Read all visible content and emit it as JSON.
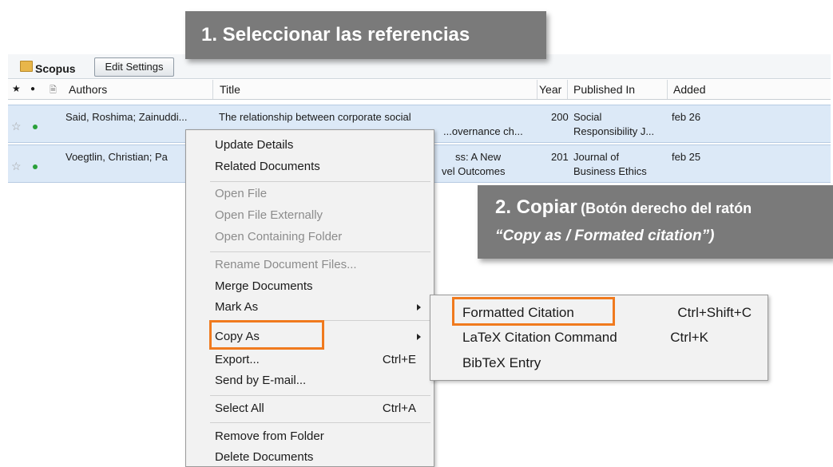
{
  "annotations": {
    "step1": "1.  Seleccionar las referencias",
    "step2_title": "2. Copiar",
    "step2_sub": "(Botón derecho del ratón",
    "step2_line2": "“Copy as / Formated citation”)"
  },
  "folder": {
    "name": "Scopus",
    "edit_settings": "Edit Settings"
  },
  "table": {
    "headers": {
      "star": "★",
      "read": "●",
      "doc": "🗎",
      "authors": "Authors",
      "title": "Title",
      "year": "Year",
      "published": "Published In",
      "added": "Added"
    },
    "rows": [
      {
        "authors": "Said, Roshima; Zainuddi...",
        "title_1": "The relationship between corporate social",
        "title_2": "...overnance ch...",
        "year": "200",
        "published_1": "Social",
        "published_2": "Responsibility J...",
        "added": "feb 26"
      },
      {
        "authors": "Voegtlin, Christian; Pa",
        "title_1": "ss: A New",
        "title_2": "vel Outcomes",
        "year": "201",
        "published_1": "Journal of",
        "published_2": "Business Ethics",
        "added": "feb 25"
      }
    ]
  },
  "context_menu": {
    "update_details": "Update Details",
    "related_documents": "Related Documents",
    "open_file": "Open File",
    "open_file_externally": "Open File Externally",
    "open_containing_folder": "Open Containing Folder",
    "rename_document_files": "Rename Document Files...",
    "merge_documents": "Merge Documents",
    "mark_as": "Mark As",
    "copy_as": "Copy As",
    "export": "Export...",
    "export_shortcut": "Ctrl+E",
    "send_by_email": "Send by E-mail...",
    "select_all": "Select All",
    "select_all_shortcut": "Ctrl+A",
    "remove_from_folder": "Remove from Folder",
    "delete_documents": "Delete Documents"
  },
  "submenu": {
    "formatted_citation": "Formatted Citation",
    "formatted_citation_shortcut": "Ctrl+Shift+C",
    "latex_citation": "LaTeX Citation Command",
    "latex_citation_shortcut": "Ctrl+K",
    "bibtex_entry": "BibTeX Entry"
  },
  "colors": {
    "highlight": "#f07a1e",
    "banner": "#7a7a7a",
    "selected_row": "#dce9f7"
  }
}
